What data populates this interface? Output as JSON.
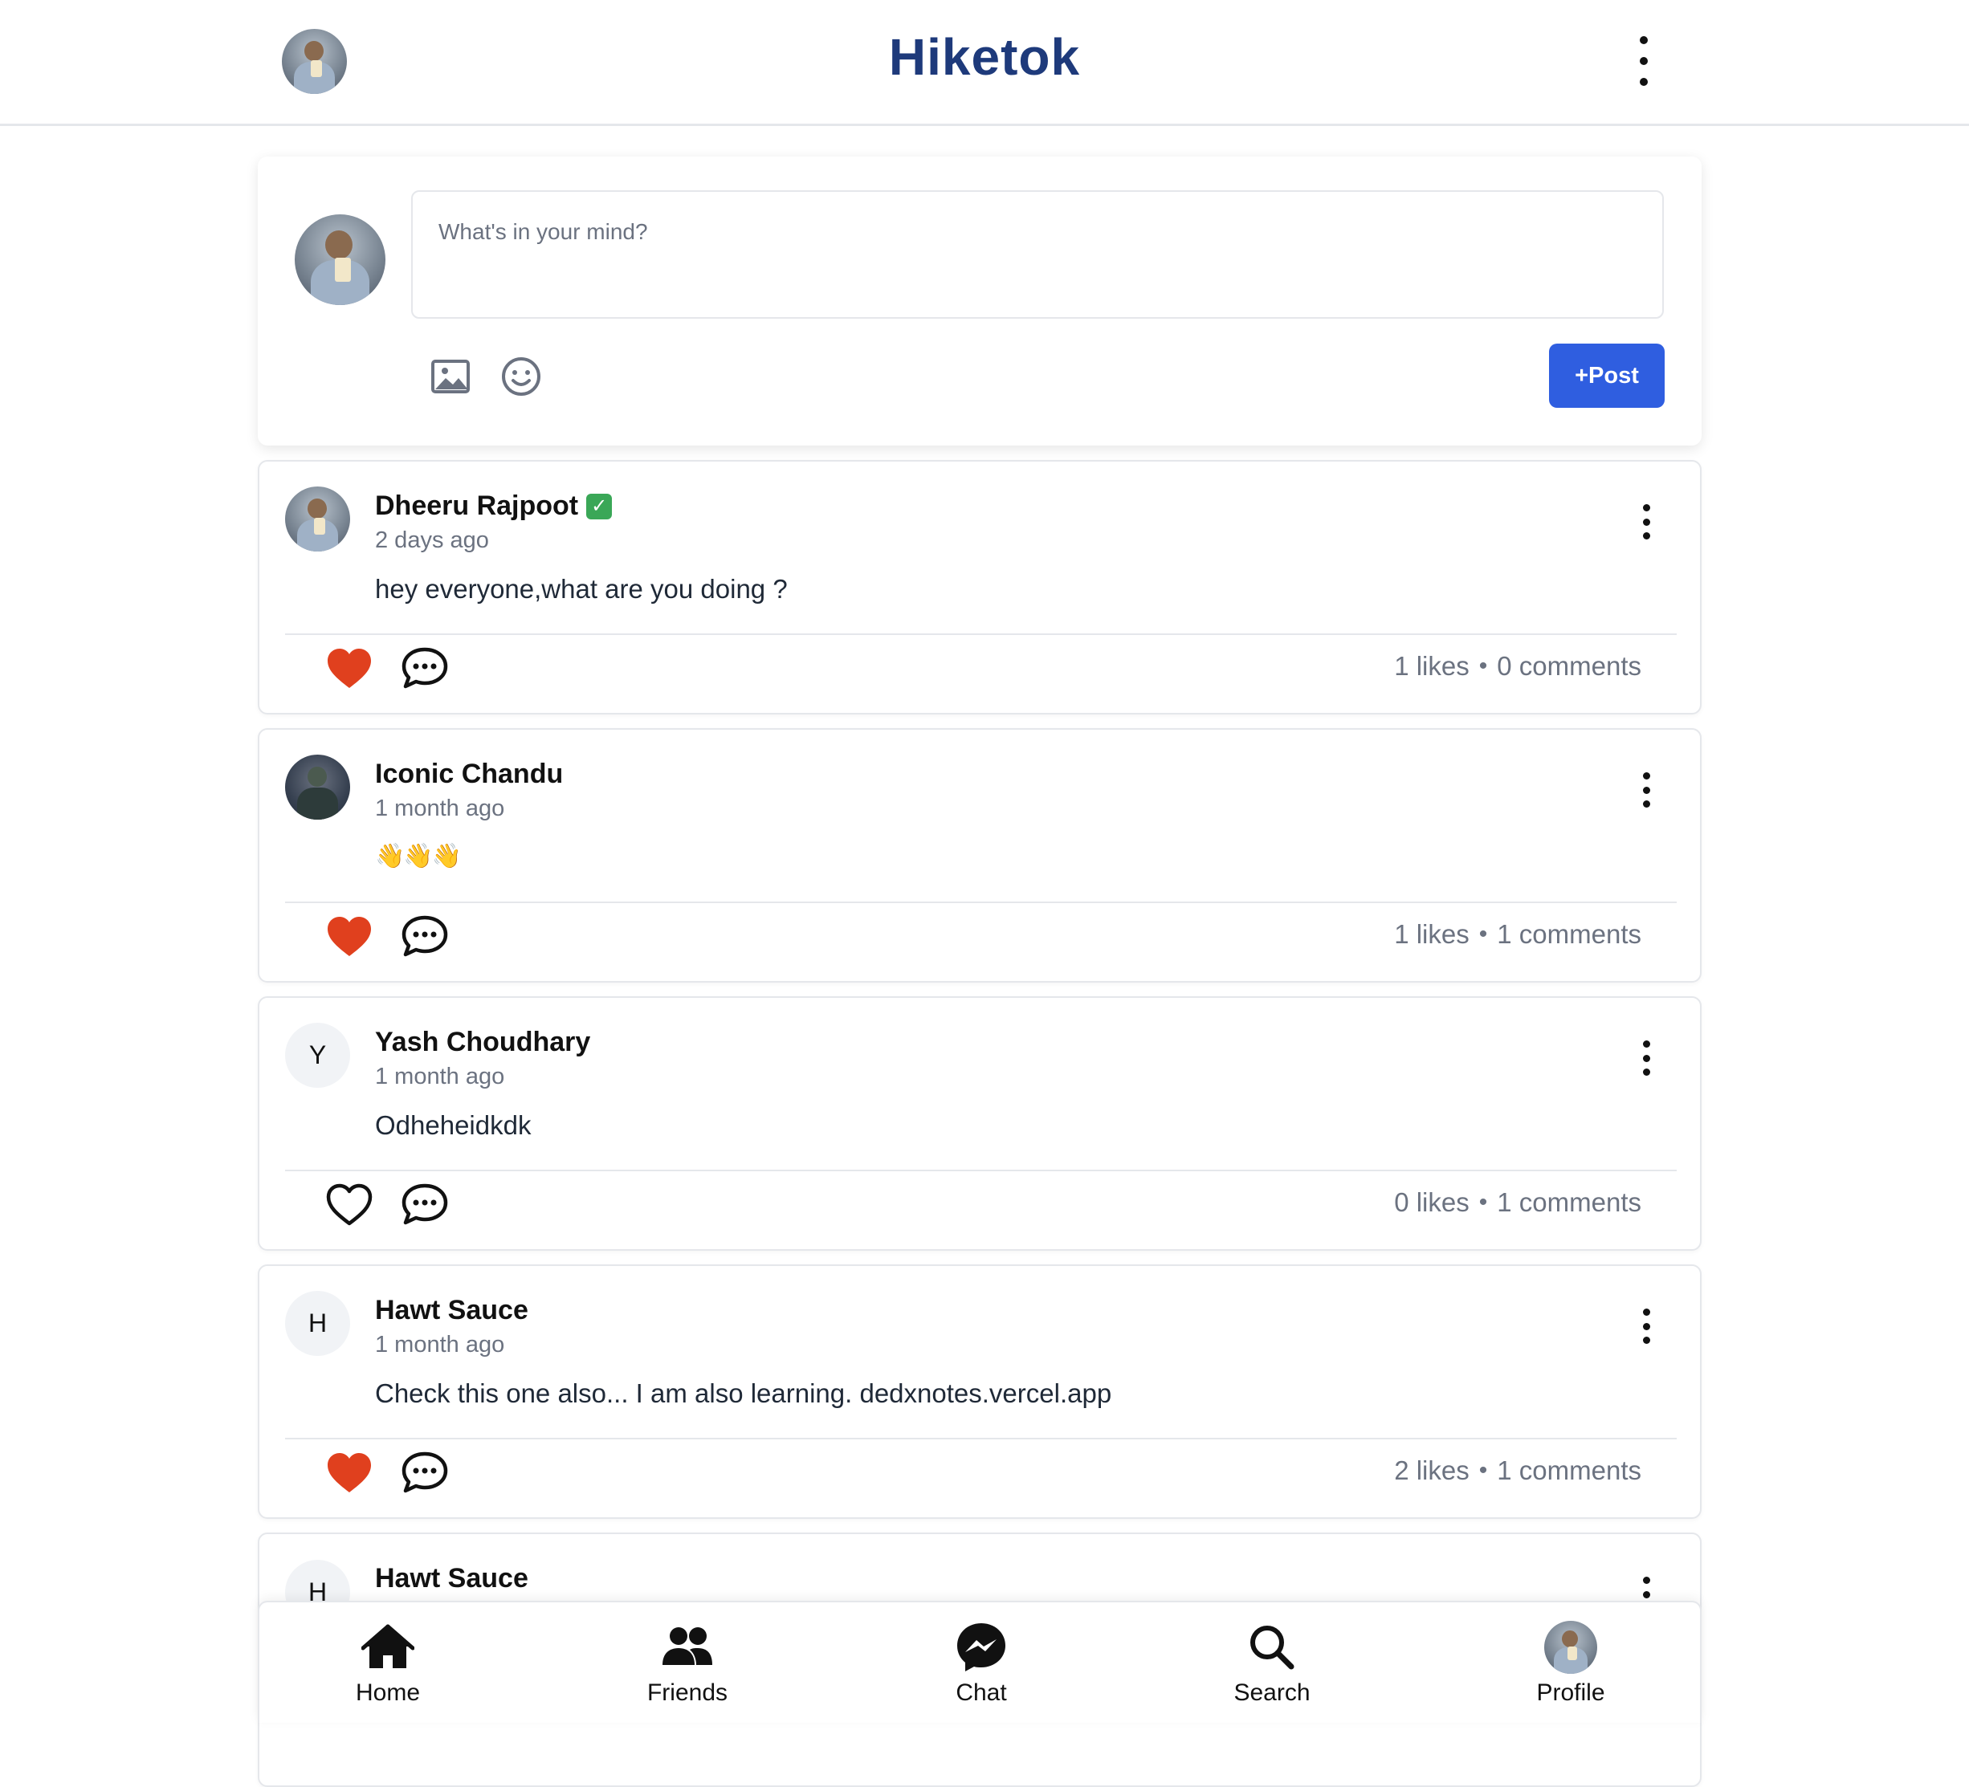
{
  "header": {
    "title": "Hiketok",
    "avatar_icon": "user-avatar-photo",
    "menu_icon": "more-vertical-icon"
  },
  "composer": {
    "placeholder": "What's in your mind?",
    "image_icon": "image-icon",
    "emoji_icon": "smile-icon",
    "post_label": "+Post",
    "post_color": "#2f5ee0"
  },
  "posts": [
    {
      "author": "Dheeru Rajpoot",
      "verified": "✓",
      "time": "2 days ago",
      "text": "hey everyone,what are you doing ?",
      "liked": true,
      "likes": "1 likes",
      "comments": "0 comments",
      "avatar": "photo"
    },
    {
      "author": "Iconic Chandu",
      "time": "1 month ago",
      "text": "👋👋👋",
      "liked": true,
      "likes": "1 likes",
      "comments": "1 comments",
      "avatar": "photo-dark"
    },
    {
      "author": "Yash Choudhary",
      "time": "1 month ago",
      "text": "Odheheidkdk",
      "liked": false,
      "likes": "0 likes",
      "comments": "1 comments",
      "avatar_letter": "Y"
    },
    {
      "author": "Hawt Sauce",
      "time": "1 month ago",
      "text": "Check this one also... I am also learning. dedxnotes.vercel.app",
      "liked": true,
      "likes": "2 likes",
      "comments": "1 comments",
      "avatar_letter": "H"
    },
    {
      "author": "Hawt Sauce",
      "avatar_letter": "H"
    }
  ],
  "stats_separator": "•",
  "colors": {
    "like_active": "#e0401e",
    "brand_title": "#1e3a7b",
    "muted_text": "#6b7280"
  },
  "bottom_nav": [
    {
      "label": "Home",
      "icon": "home-icon"
    },
    {
      "label": "Friends",
      "icon": "friends-icon"
    },
    {
      "label": "Chat",
      "icon": "messenger-icon"
    },
    {
      "label": "Search",
      "icon": "search-icon"
    },
    {
      "label": "Profile",
      "icon": "profile-avatar"
    }
  ]
}
